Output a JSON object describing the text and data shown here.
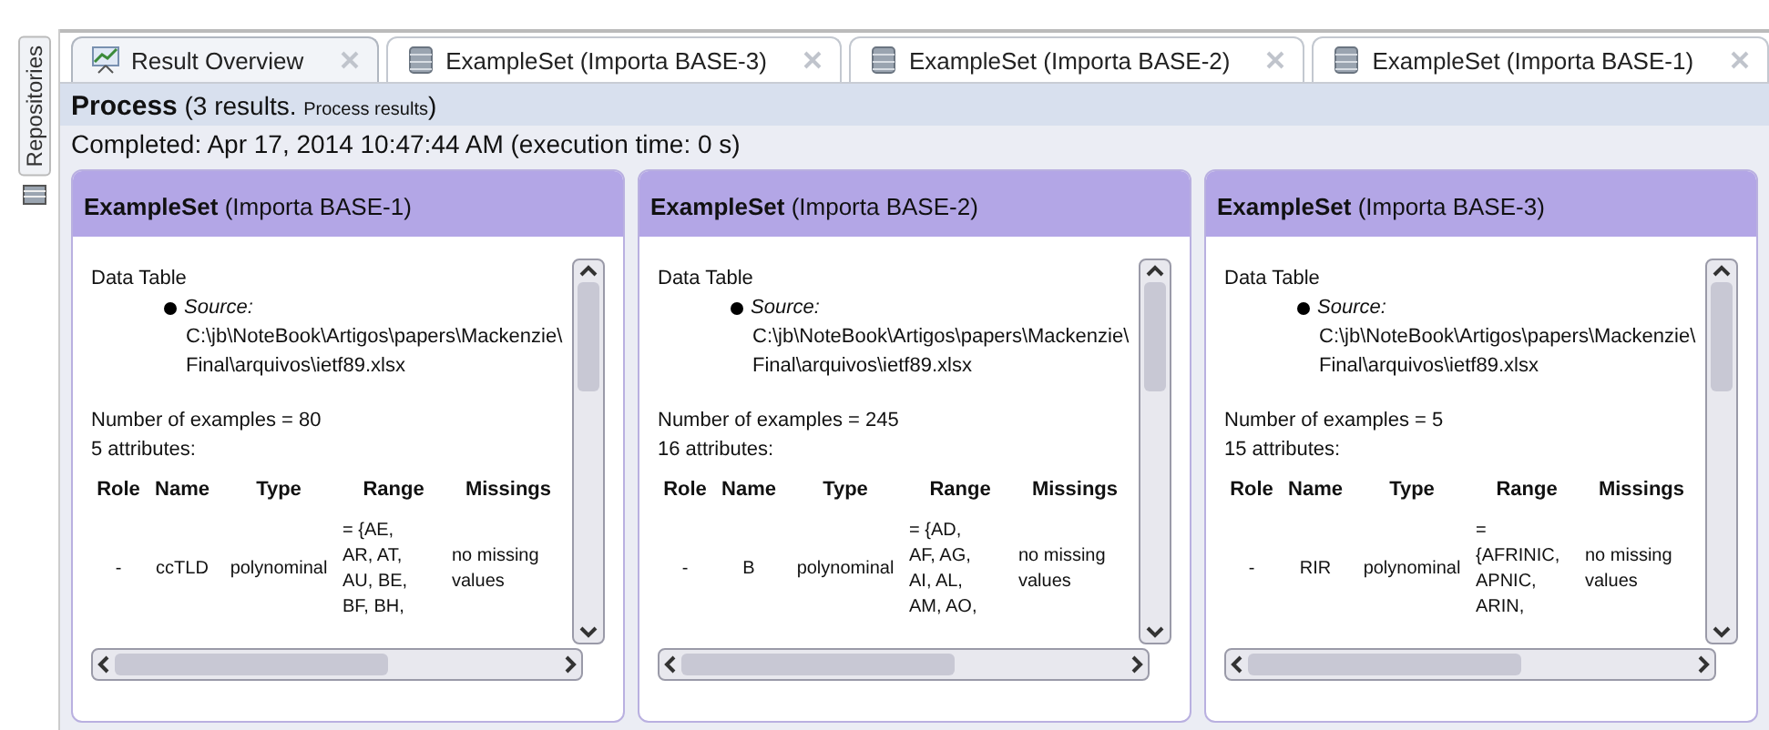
{
  "side_panel": {
    "label": "Repositories"
  },
  "tabs": [
    {
      "label": "Result Overview",
      "kind": "overview",
      "selected": true
    },
    {
      "label": "ExampleSet (Importa BASE-3)",
      "kind": "dataset",
      "selected": false
    },
    {
      "label": "ExampleSet (Importa BASE-2)",
      "kind": "dataset",
      "selected": false
    },
    {
      "label": "ExampleSet (Importa BASE-1)",
      "kind": "dataset",
      "selected": false
    }
  ],
  "process": {
    "title": "Process",
    "count": "(3 results.",
    "link": "Process results",
    "close": ")",
    "completed": "Completed: Apr 17, 2014 10:47:44 AM (execution time: 0 s)"
  },
  "results": [
    {
      "title": "ExampleSet",
      "subtitle": "(Importa BASE-1)",
      "heading": "Data Table",
      "source_label": "Source:",
      "path_lines": [
        "C:\\jb\\NoteBook\\Artigos\\papers\\Mackenzie\\",
        "Final\\arquivos\\ietf89.xlsx"
      ],
      "examples": "Number of examples = 80",
      "attributes": "5 attributes:",
      "columns": [
        "Role",
        "Name",
        "Type",
        "Range",
        "Missings"
      ],
      "row": {
        "role": "-",
        "name": "ccTLD",
        "type": "polynominal",
        "range_lines": [
          "= {AE,",
          "AR, AT,",
          "AU, BE,",
          "BF, BH,"
        ],
        "missings": "no missing values"
      }
    },
    {
      "title": "ExampleSet",
      "subtitle": "(Importa BASE-2)",
      "heading": "Data Table",
      "source_label": "Source:",
      "path_lines": [
        "C:\\jb\\NoteBook\\Artigos\\papers\\Mackenzie\\",
        "Final\\arquivos\\ietf89.xlsx"
      ],
      "examples": "Number of examples = 245",
      "attributes": "16 attributes:",
      "columns": [
        "Role",
        "Name",
        "Type",
        "Range",
        "Missings"
      ],
      "row": {
        "role": "-",
        "name": "B",
        "type": "polynominal",
        "range_lines": [
          "= {AD,",
          "AF, AG,",
          "AI, AL,",
          "AM, AO,"
        ],
        "missings": "no missing values"
      }
    },
    {
      "title": "ExampleSet",
      "subtitle": "(Importa BASE-3)",
      "heading": "Data Table",
      "source_label": "Source:",
      "path_lines": [
        "C:\\jb\\NoteBook\\Artigos\\papers\\Mackenzie\\",
        "Final\\arquivos\\ietf89.xlsx"
      ],
      "examples": "Number of examples = 5",
      "attributes": "15 attributes:",
      "columns": [
        "Role",
        "Name",
        "Type",
        "Range",
        "Missings"
      ],
      "row": {
        "role": "-",
        "name": "RIR",
        "type": "polynominal",
        "range_lines": [
          "=",
          "{AFRINIC,",
          "APNIC,",
          "ARIN,"
        ],
        "missings": "no missing values"
      }
    }
  ]
}
